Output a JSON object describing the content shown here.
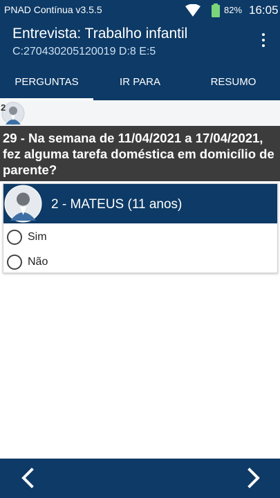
{
  "status_bar": {
    "app_name": "PNAD Contínua v3.5.5",
    "battery": "82%",
    "time": "16:05"
  },
  "header": {
    "title": "Entrevista: Trabalho infantil",
    "subtitle": "C:270430205120019 D:8 E:5",
    "menu_icon": "more-vert-icon"
  },
  "tabs": [
    {
      "label": "PERGUNTAS",
      "active": true
    },
    {
      "label": "IR PARA",
      "active": false
    },
    {
      "label": "RESUMO",
      "active": false
    }
  ],
  "mini_person": {
    "number": "2",
    "icon": "person-avatar-icon"
  },
  "question": {
    "text": "29 - Na semana de 11/04/2021 a 17/04/2021, fez alguma tarefa doméstica em domicílio de parente?"
  },
  "person_card": {
    "name": "2 - MATEUS (11 anos)",
    "options": [
      {
        "label": "Sim",
        "selected": false
      },
      {
        "label": "Não",
        "selected": false
      }
    ]
  },
  "bottom_nav": {
    "prev_icon": "chevron-left-icon",
    "next_icon": "chevron-right-icon"
  },
  "colors": {
    "primary": "#0d3a66",
    "question_bg": "#3c3c3c",
    "battery_fill": "#7bd67b"
  }
}
